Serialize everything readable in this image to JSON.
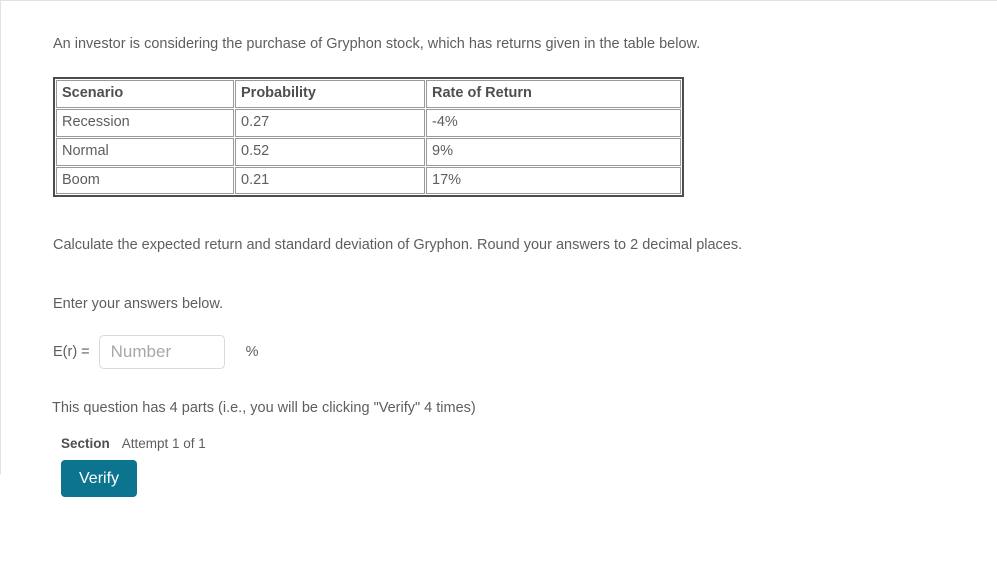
{
  "question": {
    "intro": "An investor is considering the purchase of Gryphon stock, which has returns given in the table below.",
    "instruction": "Calculate the expected return and standard deviation of Gryphon. Round your answers to 2 decimal places.",
    "enter_prompt": "Enter your answers below.",
    "parts_note": "This question has 4 parts (i.e., you will be clicking \"Verify\" 4 times)"
  },
  "returns_table": {
    "headers": [
      "Scenario",
      "Probability",
      "Rate of Return"
    ],
    "rows": [
      [
        "Recession",
        "0.27",
        "-4%"
      ],
      [
        "Normal",
        "0.52",
        "9%"
      ],
      [
        "Boom",
        "0.21",
        "17%"
      ]
    ]
  },
  "answer": {
    "label": "E(r) =",
    "value": "",
    "placeholder": "Number",
    "unit": "%"
  },
  "footer": {
    "section_label": "Section",
    "attempt_label": "Attempt 1 of 1",
    "verify_label": "Verify",
    "accent_color": "#0d7490"
  }
}
